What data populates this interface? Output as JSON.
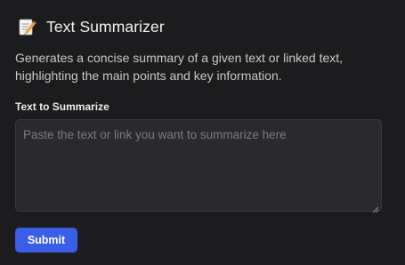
{
  "app": {
    "title": "Text Summarizer",
    "icon": "memo-icon",
    "description": "Generates a concise summary of a given text or linked text, highlighting the main points and key information."
  },
  "form": {
    "field_label": "Text to Summarize",
    "field_value": "",
    "field_placeholder": "Paste the text or link you want to summarize here",
    "submit_label": "Submit"
  },
  "colors": {
    "background": "#1c1c1e",
    "input_background": "#2a2a2d",
    "accent": "#3a5ee6"
  }
}
